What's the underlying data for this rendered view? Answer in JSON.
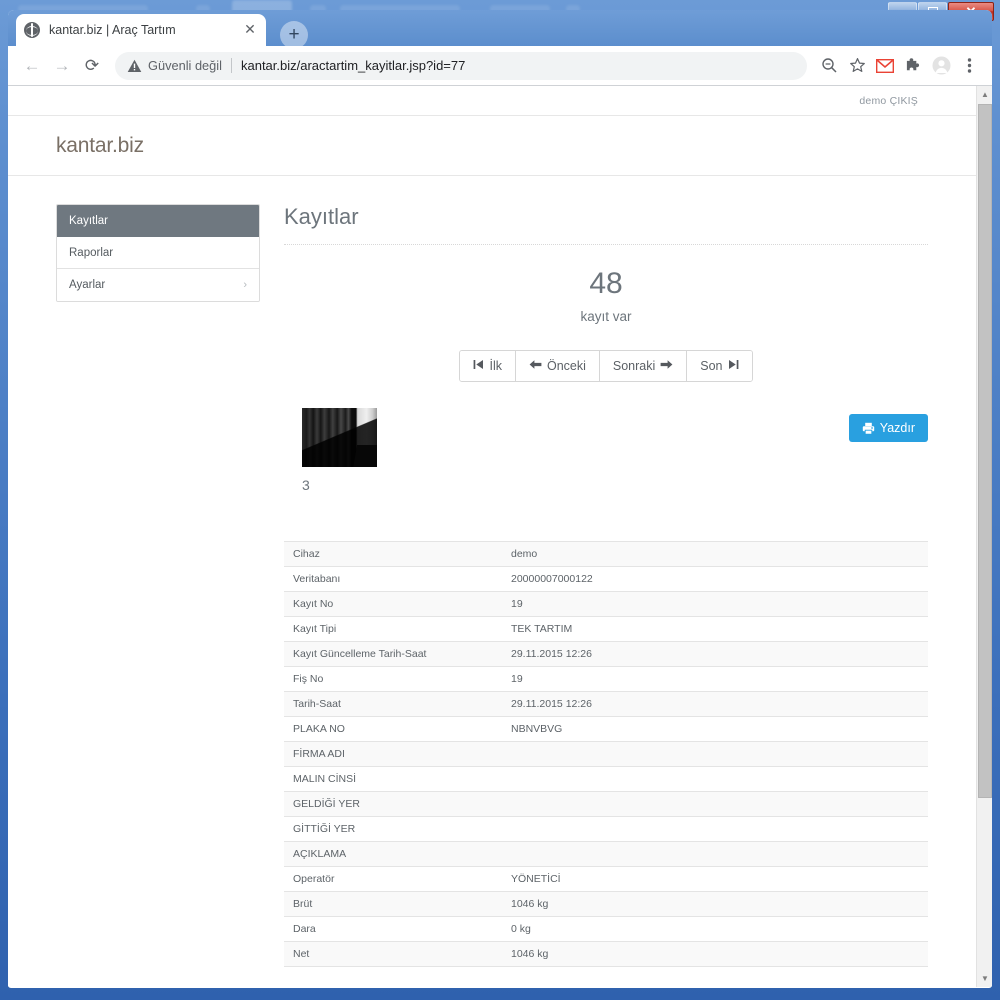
{
  "window": {
    "minimize_label": "Minimize",
    "maximize_label": "Maximize",
    "close_label": "✕"
  },
  "browser": {
    "tab": {
      "title": "kantar.biz | Araç Tartım",
      "close_label": "✕",
      "favicon": "globe-icon"
    },
    "new_tab_label": "+",
    "back_label": "←",
    "forward_label": "→",
    "reload_label": "⟳",
    "omnibox": {
      "security_label": "Güvenli değil",
      "url": "kantar.biz/aractartim_kayitlar.jsp?id=77",
      "security_icon": "warning-triangle-icon"
    },
    "toolbar_icons": [
      "zoom-out-icon",
      "bookmark-star-icon",
      "gmail-icon",
      "extensions-puzzle-icon",
      "profile-avatar-icon",
      "chrome-menu-icon"
    ]
  },
  "page": {
    "topbar": {
      "user_text": "demo ÇIKIŞ"
    },
    "brand": "kantar.biz",
    "sidebar": {
      "items": [
        {
          "label": "Kayıtlar",
          "active": true,
          "chevron": ""
        },
        {
          "label": "Raporlar",
          "active": false,
          "chevron": ""
        },
        {
          "label": "Ayarlar",
          "active": false,
          "chevron": "›"
        }
      ]
    },
    "main": {
      "title": "Kayıtlar",
      "count": "48",
      "count_label": "kayıt var",
      "pager": [
        {
          "icon": "⏮",
          "label": "İlk",
          "icon_side": "left"
        },
        {
          "icon": "➜",
          "label": "Önceki",
          "icon_side": "left"
        },
        {
          "icon": "➜",
          "label": "Sonraki",
          "icon_side": "right"
        },
        {
          "icon": "⏭",
          "label": "Son",
          "icon_side": "right"
        }
      ],
      "thumbnail_caption": "3",
      "print_button": "Yazdır",
      "accent_color": "#29a0e0",
      "detail_rows": [
        {
          "key": "Cihaz",
          "value": "demo"
        },
        {
          "key": "Veritabanı",
          "value": "20000007000122"
        },
        {
          "key": "Kayıt No",
          "value": "19"
        },
        {
          "key": "Kayıt Tipi",
          "value": "TEK TARTIM"
        },
        {
          "key": "Kayıt Güncelleme Tarih-Saat",
          "value": "29.11.2015 12:26"
        },
        {
          "key": "Fiş No",
          "value": "19"
        },
        {
          "key": "Tarih-Saat",
          "value": "29.11.2015 12:26"
        },
        {
          "key": "PLAKA NO",
          "value": "NBNVBVG"
        },
        {
          "key": "FİRMA ADI",
          "value": ""
        },
        {
          "key": "MALIN CİNSİ",
          "value": ""
        },
        {
          "key": "GELDİĞİ YER",
          "value": ""
        },
        {
          "key": "GİTTİĞİ YER",
          "value": ""
        },
        {
          "key": "AÇIKLAMA",
          "value": ""
        },
        {
          "key": "Operatör",
          "value": "YÖNETİCİ"
        },
        {
          "key": "Brüt",
          "value": "1046 kg"
        },
        {
          "key": "Dara",
          "value": "0 kg"
        },
        {
          "key": "Net",
          "value": "1046 kg"
        }
      ]
    }
  }
}
